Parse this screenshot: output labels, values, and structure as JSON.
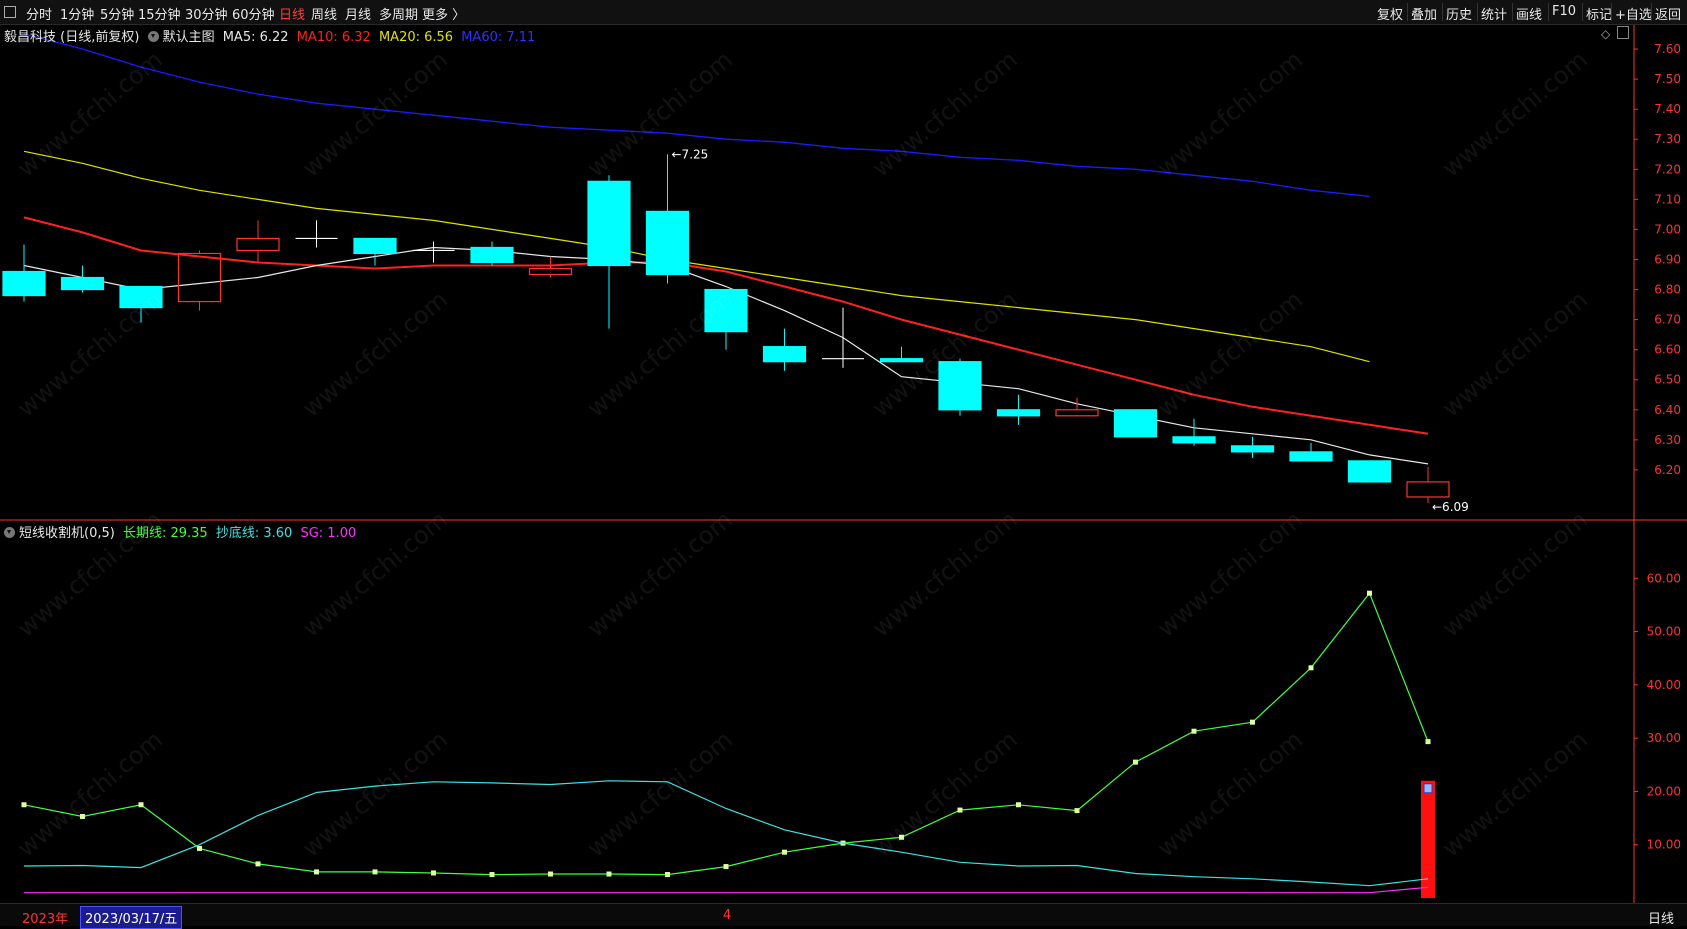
{
  "toolbar": {
    "periods": [
      {
        "label": "分时",
        "active": false
      },
      {
        "label": "1分钟",
        "active": false
      },
      {
        "label": "5分钟",
        "active": false
      },
      {
        "label": "15分钟",
        "active": false
      },
      {
        "label": "30分钟",
        "active": false
      },
      {
        "label": "60分钟",
        "active": false
      },
      {
        "label": "日线",
        "active": true
      },
      {
        "label": "周线",
        "active": false
      },
      {
        "label": "月线",
        "active": false
      },
      {
        "label": "多周期",
        "active": false
      },
      {
        "label": "更多 〉",
        "active": false
      }
    ],
    "right_items": [
      "复权",
      "叠加",
      "历史",
      "统计",
      "画线",
      "F10",
      "标记",
      "+自选",
      "返回"
    ]
  },
  "main_legend": {
    "title": "毅昌科技 (日线,前复权)",
    "indicator": "默认主图",
    "ma5": "MA5: 6.22",
    "ma10": "MA10: 6.32",
    "ma20": "MA20: 6.56",
    "ma60": "MA60: 7.11"
  },
  "sub_legend": {
    "title": "短线收割机(0,5)",
    "long": "长期线: 29.35",
    "bottom": "抄底线: 3.60",
    "sg": "SG: 1.00"
  },
  "bottom_bar": {
    "year": "2023年",
    "date": "2023/03/17/五",
    "marker": "4",
    "period": "日线"
  },
  "watermark": "www.cfchi.com",
  "colors": {
    "up": "#ff3232",
    "down": "#00ffff",
    "ma5": "#e8e8e8",
    "ma10": "#ff2020",
    "ma20": "#e0e000",
    "ma60": "#1a1aff",
    "long": "#40ff40",
    "bottom": "#40e0e0",
    "sg": "#ff30ff",
    "axis": "#ff3232"
  },
  "chart_data": [
    {
      "type": "candlestick",
      "title": "毅昌科技 (日线,前复权)",
      "ylim": [
        6.05,
        7.68
      ],
      "yticks": [
        "7.60",
        "7.50",
        "7.40",
        "7.30",
        "7.20",
        "7.10",
        "7.00",
        "6.90",
        "6.80",
        "6.70",
        "6.60",
        "6.50",
        "6.40",
        "6.30",
        "6.20"
      ],
      "candles": [
        {
          "o": 6.86,
          "h": 6.95,
          "l": 6.76,
          "c": 6.78
        },
        {
          "o": 6.84,
          "h": 6.88,
          "l": 6.79,
          "c": 6.8
        },
        {
          "o": 6.81,
          "h": 6.81,
          "l": 6.69,
          "c": 6.74
        },
        {
          "o": 6.76,
          "h": 6.93,
          "l": 6.73,
          "c": 6.92
        },
        {
          "o": 6.93,
          "h": 7.03,
          "l": 6.89,
          "c": 6.97
        },
        {
          "o": 6.97,
          "h": 7.03,
          "l": 6.94,
          "c": 6.97
        },
        {
          "o": 6.97,
          "h": 6.97,
          "l": 6.88,
          "c": 6.92
        },
        {
          "o": 6.93,
          "h": 6.96,
          "l": 6.89,
          "c": 6.93
        },
        {
          "o": 6.94,
          "h": 6.96,
          "l": 6.88,
          "c": 6.89
        },
        {
          "o": 6.85,
          "h": 6.91,
          "l": 6.84,
          "c": 6.87
        },
        {
          "o": 7.16,
          "h": 7.18,
          "l": 6.67,
          "c": 6.88
        },
        {
          "o": 7.06,
          "h": 7.25,
          "l": 6.82,
          "c": 6.85
        },
        {
          "o": 6.8,
          "h": 6.8,
          "l": 6.6,
          "c": 6.66
        },
        {
          "o": 6.61,
          "h": 6.67,
          "l": 6.53,
          "c": 6.56
        },
        {
          "o": 6.57,
          "h": 6.74,
          "l": 6.54,
          "c": 6.57
        },
        {
          "o": 6.57,
          "h": 6.61,
          "l": 6.56,
          "c": 6.56
        },
        {
          "o": 6.56,
          "h": 6.57,
          "l": 6.38,
          "c": 6.4
        },
        {
          "o": 6.4,
          "h": 6.45,
          "l": 6.35,
          "c": 6.38
        },
        {
          "o": 6.38,
          "h": 6.44,
          "l": 6.38,
          "c": 6.4
        },
        {
          "o": 6.4,
          "h": 6.4,
          "l": 6.31,
          "c": 6.31
        },
        {
          "o": 6.31,
          "h": 6.37,
          "l": 6.28,
          "c": 6.29
        },
        {
          "o": 6.28,
          "h": 6.31,
          "l": 6.24,
          "c": 6.26
        },
        {
          "o": 6.26,
          "h": 6.29,
          "l": 6.23,
          "c": 6.23
        },
        {
          "o": 6.23,
          "h": 6.23,
          "l": 6.16,
          "c": 6.16
        },
        {
          "o": 6.11,
          "h": 6.21,
          "l": 6.09,
          "c": 6.16
        }
      ],
      "ma5": [
        6.88,
        6.84,
        6.8,
        6.82,
        6.84,
        6.88,
        6.91,
        6.94,
        6.93,
        6.91,
        6.9,
        6.88,
        6.81,
        6.73,
        6.64,
        6.51,
        6.49,
        6.47,
        6.42,
        6.38,
        6.34,
        6.32,
        6.3,
        6.25,
        6.22
      ],
      "ma10": [
        7.04,
        6.99,
        6.93,
        6.91,
        6.89,
        6.88,
        6.87,
        6.88,
        6.88,
        6.88,
        6.89,
        6.89,
        6.86,
        6.81,
        6.76,
        6.7,
        6.65,
        6.6,
        6.55,
        6.5,
        6.45,
        6.41,
        6.38,
        6.35,
        6.32
      ],
      "ma20": [
        7.26,
        7.22,
        7.17,
        7.13,
        7.1,
        7.07,
        7.05,
        7.03,
        7.0,
        6.97,
        6.94,
        6.9,
        6.87,
        6.84,
        6.81,
        6.78,
        6.76,
        6.74,
        6.72,
        6.7,
        6.67,
        6.64,
        6.61,
        6.56
      ],
      "ma60": [
        7.65,
        7.6,
        7.54,
        7.49,
        7.45,
        7.42,
        7.4,
        7.38,
        7.36,
        7.34,
        7.33,
        7.32,
        7.3,
        7.29,
        7.27,
        7.26,
        7.24,
        7.23,
        7.21,
        7.2,
        7.18,
        7.16,
        7.13,
        7.11
      ],
      "annotations": [
        {
          "label": "7.25",
          "value": 7.25,
          "candle": 11
        },
        {
          "label": "6.09",
          "value": 6.09,
          "candle": 24
        }
      ]
    },
    {
      "type": "line",
      "title": "短线收割机(0,5)",
      "ylim": [
        0,
        70
      ],
      "yticks": [
        "60.00",
        "50.00",
        "40.00",
        "30.00",
        "20.00",
        "10.00"
      ],
      "series": [
        {
          "name": "长期线",
          "values": [
            17.5,
            15.3,
            17.5,
            9.3,
            6.4,
            4.9,
            4.9,
            4.7,
            4.4,
            4.5,
            4.5,
            4.4,
            5.9,
            8.6,
            10.3,
            11.4,
            16.5,
            17.5,
            16.4,
            25.5,
            31.3,
            33.0,
            43.2,
            57.2,
            29.35
          ]
        },
        {
          "name": "抄底线",
          "values": [
            6.0,
            6.1,
            5.7,
            10.0,
            15.5,
            19.8,
            21.0,
            21.8,
            21.6,
            21.3,
            22.0,
            21.8,
            16.8,
            12.8,
            10.3,
            8.6,
            6.7,
            6.0,
            6.1,
            4.6,
            4.0,
            3.6,
            3.0,
            2.3,
            3.6
          ]
        },
        {
          "name": "SG",
          "values": [
            1.0,
            1.0,
            1.0,
            1.0,
            1.0,
            1.0,
            1.0,
            1.0,
            1.0,
            1.0,
            1.0,
            1.0,
            1.0,
            1.0,
            1.0,
            1.0,
            1.0,
            1.0,
            1.0,
            1.0,
            1.0,
            1.0,
            1.0,
            1.0,
            2.0
          ]
        }
      ],
      "signal_bar": {
        "candle": 24,
        "top": 22.0,
        "bottom": 0
      }
    }
  ]
}
